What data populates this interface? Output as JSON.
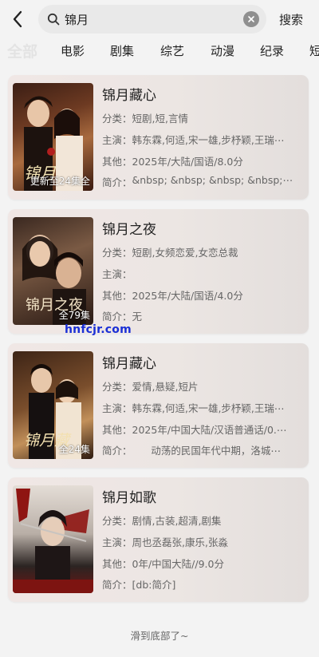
{
  "header": {
    "back_icon": "chevron-left-icon",
    "search_value": "锦月",
    "search_icon": "search-icon",
    "clear_icon": "clear-icon",
    "search_button": "搜索"
  },
  "tabs": [
    "全部",
    "电影",
    "剧集",
    "综艺",
    "动漫",
    "纪录",
    "短"
  ],
  "results": [
    {
      "title": "锦月藏心",
      "badge": "更新至24集全",
      "category_label": "分类：",
      "category": "短剧,短,言情",
      "cast_label": "主演：",
      "cast": "韩东霖,何适,宋一雄,步杼颖,王瑞⋯",
      "other_label": "其他：",
      "other": "2025年/大陆/国语/8.0分",
      "intro_label": "简介：",
      "intro": "&nbsp; &nbsp; &nbsp; &nbsp;⋯"
    },
    {
      "title": "锦月之夜",
      "badge": "全79集",
      "category_label": "分类：",
      "category": "短剧,女频恋爱,女恋总裁",
      "cast_label": "主演：",
      "cast": "",
      "other_label": "其他：",
      "other": "2025年/大陆/国语/4.0分",
      "intro_label": "简介：",
      "intro": "无"
    },
    {
      "title": "锦月藏心",
      "badge": "全24集",
      "category_label": "分类：",
      "category": "爱情,悬疑,短片",
      "cast_label": "主演：",
      "cast": "韩东霖,何适,宋一雄,步杼颖,王瑞⋯",
      "other_label": "其他：",
      "other": "2025年/中国大陆/汉语普通话/0.⋯",
      "intro_label": "简介：",
      "intro": "      动荡的民国年代中期，洛城⋯"
    },
    {
      "title": "锦月如歌",
      "badge": "",
      "category_label": "分类：",
      "category": "剧情,古装,超清,剧集",
      "cast_label": "主演：",
      "cast": "周也丞磊张,康乐,张淼",
      "other_label": "其他：",
      "other": "0年/中国大陆//9.0分",
      "intro_label": "简介：",
      "intro": "[db:简介]"
    }
  ],
  "watermark": "hnfcjr.com",
  "footer": "滑到底部了~",
  "colors": {
    "accent_watermark": "#1a2fd6",
    "tab_active": "#e3e3e3"
  }
}
